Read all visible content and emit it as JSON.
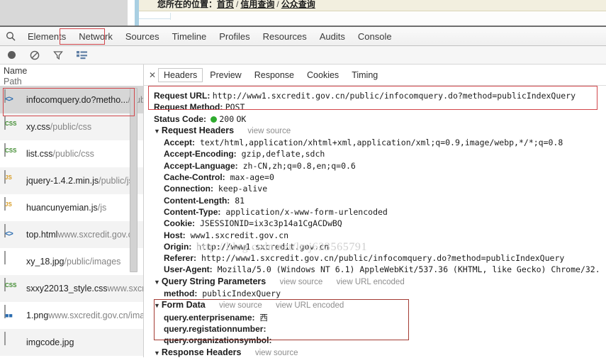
{
  "page": {
    "breadcrumb_label": "您所在的位置：",
    "crumb_home": "首页",
    "crumb_sep": "/",
    "crumb_mid": "信用查询",
    "crumb_last": "公众查询"
  },
  "devtools": {
    "search_icon": "search-icon",
    "tabs": [
      {
        "label": "Elements",
        "selected": false
      },
      {
        "label": "Network",
        "selected": true
      },
      {
        "label": "Sources",
        "selected": false
      },
      {
        "label": "Timeline",
        "selected": false
      },
      {
        "label": "Profiles",
        "selected": false
      },
      {
        "label": "Resources",
        "selected": false
      },
      {
        "label": "Audits",
        "selected": false
      },
      {
        "label": "Console",
        "selected": false
      }
    ],
    "toolbar": [
      {
        "icon": "record-icon"
      },
      {
        "icon": "clear-icon"
      },
      {
        "icon": "filter-icon"
      },
      {
        "icon": "list-view-icon"
      }
    ],
    "highlight_color": "#d1454a"
  },
  "sidebar": {
    "col_name": "Name",
    "col_path": "Path",
    "rows": [
      {
        "name": "infocomquery.do?metho...",
        "path": "/public",
        "kind": "html"
      },
      {
        "name": "xy.css",
        "path": "/public/css",
        "kind": "css"
      },
      {
        "name": "list.css",
        "path": "/public/css",
        "kind": "css"
      },
      {
        "name": "jquery-1.4.2.min.js",
        "path": "/public/js",
        "kind": "js"
      },
      {
        "name": "huancunyemian.js",
        "path": "/js",
        "kind": "js"
      },
      {
        "name": "top.html",
        "path": "www.sxcredit.gov.cn",
        "kind": "html"
      },
      {
        "name": "xy_18.jpg",
        "path": "/public/images",
        "kind": "img"
      },
      {
        "name": "sxxy22013_style.css",
        "path": "www.sxcredit.gov.cn/css",
        "kind": "css"
      },
      {
        "name": "1.png",
        "path": "www.sxcredit.gov.cn/imag",
        "kind": "png"
      },
      {
        "name": "imgcode.jpg",
        "path": "",
        "kind": "img"
      }
    ]
  },
  "panel": {
    "close_icon": "close-icon",
    "tabs": [
      {
        "label": "Headers",
        "active": true
      },
      {
        "label": "Preview",
        "active": false
      },
      {
        "label": "Response",
        "active": false
      },
      {
        "label": "Cookies",
        "active": false
      },
      {
        "label": "Timing",
        "active": false
      }
    ],
    "general": {
      "request_url_key": "Request URL:",
      "request_url_value": "http://www1.sxcredit.gov.cn/public/infocomquery.do?method=publicIndexQuery",
      "request_method_key": "Request Method:",
      "request_method_value": "POST",
      "status_code_key": "Status Code:",
      "status_code_value": "200",
      "status_code_text": "OK",
      "status_dot_color": "#2fab2f"
    },
    "request_headers": {
      "title": "Request Headers",
      "view_source": "view source",
      "items": [
        {
          "key": "Accept:",
          "value": "text/html,application/xhtml+xml,application/xml;q=0.9,image/webp,*/*;q=0.8"
        },
        {
          "key": "Accept-Encoding:",
          "value": "gzip,deflate,sdch"
        },
        {
          "key": "Accept-Language:",
          "value": "zh-CN,zh;q=0.8,en;q=0.6"
        },
        {
          "key": "Cache-Control:",
          "value": "max-age=0"
        },
        {
          "key": "Connection:",
          "value": "keep-alive"
        },
        {
          "key": "Content-Length:",
          "value": "81"
        },
        {
          "key": "Content-Type:",
          "value": "application/x-www-form-urlencoded"
        },
        {
          "key": "Cookie:",
          "value": "JSESSIONID=ix3c3p14a1CgACDwBQ"
        },
        {
          "key": "Host:",
          "value": "www1.sxcredit.gov.cn"
        },
        {
          "key": "Origin:",
          "value": "http://www1.sxcredit.gov.cn"
        },
        {
          "key": "Referer:",
          "value": "http://www1.sxcredit.gov.cn/public/infocomquery.do?method=publicIndexQuery"
        },
        {
          "key": "User-Agent:",
          "value": "Mozilla/5.0 (Windows NT 6.1) AppleWebKit/537.36 (KHTML, like Gecko) Chrome/32."
        }
      ]
    },
    "query_string": {
      "title": "Query String Parameters",
      "view_source": "view source",
      "view_url_encoded": "view URL encoded",
      "items": [
        {
          "key": "method:",
          "value": "publicIndexQuery"
        }
      ]
    },
    "form_data": {
      "title": "Form Data",
      "view_source": "view source",
      "view_url_encoded": "view URL encoded",
      "items": [
        {
          "key": "query.enterprisename:",
          "value": "西"
        },
        {
          "key": "query.registationnumber:",
          "value": ""
        },
        {
          "key": "query.organizationsymbol:",
          "value": ""
        }
      ]
    },
    "response_headers": {
      "title": "Response Headers",
      "view_source": "view source"
    }
  },
  "watermark": "http://blog.csdn.net/lmj623565791"
}
